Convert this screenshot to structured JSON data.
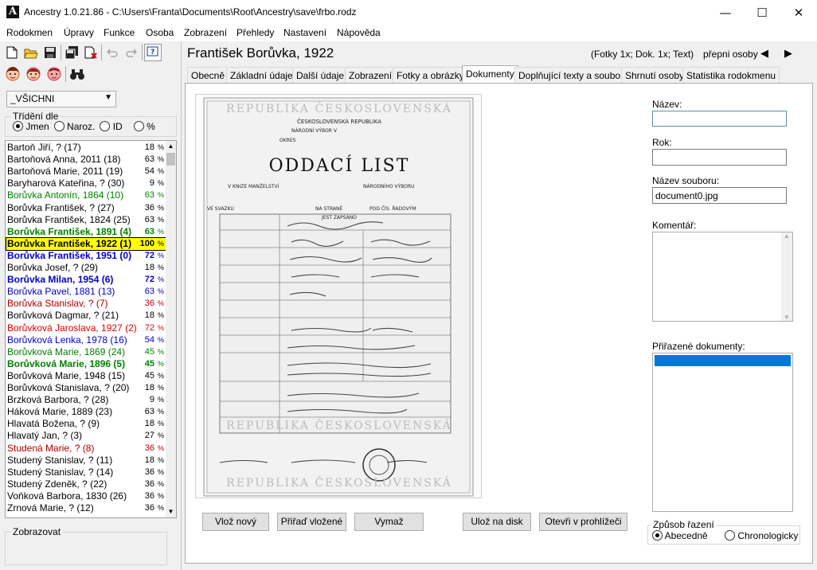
{
  "window": {
    "title": "Ancestry 1.0.21.86 - C:\\Users\\Franta\\Documents\\Root\\Ancestry\\save\\frbo.rodz",
    "app_icon_letter": "A"
  },
  "menu": [
    "Rodokmen",
    "Úpravy",
    "Funkce",
    "Osoba",
    "Zobrazení",
    "Přehledy",
    "Nastavení",
    "Nápověda"
  ],
  "left": {
    "filter_value": "_VŠICHNI",
    "sort_label": "Třídění dle",
    "sort_options": [
      "Jmen",
      "Naroz.",
      "ID",
      "%"
    ],
    "show_label": "Zobrazovat",
    "persons": [
      {
        "name": "Bartoň Jiří, ? (17)",
        "num": "18",
        "color": "#000000",
        "bold": false
      },
      {
        "name": "Bartoňová Anna, 2011 (18)",
        "num": "63",
        "color": "#000000",
        "bold": false
      },
      {
        "name": "Bartoňová Marie, 2011 (19)",
        "num": "54",
        "color": "#000000",
        "bold": false
      },
      {
        "name": "Baryharová Kateřina, ? (30)",
        "num": "9",
        "color": "#000000",
        "bold": false
      },
      {
        "name": "Borůvka Antonín, 1864 (10)",
        "num": "63",
        "color": "#008000",
        "bold": false
      },
      {
        "name": "Borůvka František, ? (27)",
        "num": "36",
        "color": "#000000",
        "bold": false
      },
      {
        "name": "Borůvka František, 1824 (25)",
        "num": "63",
        "color": "#000000",
        "bold": false
      },
      {
        "name": "Borůvka František, 1891 (4)",
        "num": "63",
        "color": "#008000",
        "bold": true
      },
      {
        "name": "Borůvka František, 1922 (1)",
        "num": "100",
        "color": "#000000",
        "bold": true,
        "selected": true
      },
      {
        "name": "Borůvka František, 1951 (0)",
        "num": "72",
        "color": "#0000cc",
        "bold": true
      },
      {
        "name": "Borůvka Josef, ? (29)",
        "num": "18",
        "color": "#000000",
        "bold": false
      },
      {
        "name": "Borůvka Milan, 1954 (6)",
        "num": "72",
        "color": "#0000cc",
        "bold": true
      },
      {
        "name": "Borůvka Pavel, 1881 (13)",
        "num": "63",
        "color": "#0000cc",
        "bold": false
      },
      {
        "name": "Borůvka Stanislav, ? (7)",
        "num": "36",
        "color": "#b00000",
        "bold": false
      },
      {
        "name": "Borůvková Dagmar, ? (21)",
        "num": "18",
        "color": "#000000",
        "bold": false
      },
      {
        "name": "Borůvková Jaroslava, 1927 (2)",
        "num": "72",
        "color": "#e00000",
        "bold": false
      },
      {
        "name": "Borůvková Lenka, 1978 (16)",
        "num": "54",
        "color": "#0000cc",
        "bold": false
      },
      {
        "name": "Borůvková Marie, 1869 (24)",
        "num": "45",
        "color": "#008000",
        "bold": false
      },
      {
        "name": "Borůvková Marie, 1896 (5)",
        "num": "45",
        "color": "#008000",
        "bold": true
      },
      {
        "name": "Borůvková Marie, 1948 (15)",
        "num": "45",
        "color": "#000000",
        "bold": false
      },
      {
        "name": "Borůvková Stanislava, ? (20)",
        "num": "18",
        "color": "#000000",
        "bold": false
      },
      {
        "name": "Brzková Barbora, ? (28)",
        "num": "9",
        "color": "#000000",
        "bold": false
      },
      {
        "name": "Háková Marie, 1889 (23)",
        "num": "63",
        "color": "#000000",
        "bold": false
      },
      {
        "name": "Hlavatá Božena, ? (9)",
        "num": "18",
        "color": "#000000",
        "bold": false
      },
      {
        "name": "Hlavatý Jan, ? (3)",
        "num": "27",
        "color": "#000000",
        "bold": false
      },
      {
        "name": "Studená Marie, ? (8)",
        "num": "36",
        "color": "#b00000",
        "bold": false
      },
      {
        "name": "Studený Stanislav, ? (11)",
        "num": "18",
        "color": "#000000",
        "bold": false
      },
      {
        "name": "Studený Stanislav, ? (14)",
        "num": "36",
        "color": "#000000",
        "bold": false
      },
      {
        "name": "Studený Zdeněk, ? (22)",
        "num": "36",
        "color": "#000000",
        "bold": false
      },
      {
        "name": "Voňková Barbora, 1830 (26)",
        "num": "36",
        "color": "#000000",
        "bold": false
      },
      {
        "name": "Zrnová Marie, ? (12)",
        "num": "36",
        "color": "#000000",
        "bold": false
      }
    ]
  },
  "header": {
    "person_title": "František Borůvka, 1922",
    "counts": "(Fotky 1x; Dok. 1x; Text)",
    "switch_label": "přepni osoby"
  },
  "tabs": [
    "Obecně",
    "Základní údaje",
    "Další údaje",
    "Zobrazení",
    "Fotky a obrázky",
    "Dokumenty",
    "Doplňující texty a soubory",
    "Shrnutí osoby",
    "Statistika rodokmenu"
  ],
  "active_tab": "Dokumenty",
  "document": {
    "image_lines": {
      "top_banner": "REPUBLIKA ČESKOSLOVENSKÁ",
      "state": "ČESKOSLOVENSKÁ REPUBLIKA",
      "committee": "NÁRODNÍ VÝBOR V",
      "district": "OKRES",
      "title": "ODDACÍ LIST",
      "book": "V KNIZE MANŽELSTVÍ",
      "committee2": "NÁRODNÍHO VÝBORU",
      "volume": "VE SVAZKU",
      "page": "NA STRANĚ",
      "order": "POD ČÍS. ŘADOVÝM",
      "registered": "JEST ZAPSÁNO",
      "bottom_banner": "REPUBLIKA ČESKOSLOVENSKÁ"
    },
    "form": {
      "name_label": "Název:",
      "name_value": "",
      "year_label": "Rok:",
      "year_value": "",
      "file_label": "Název souboru:",
      "file_value": "document0.jpg",
      "comment_label": "Komentář:",
      "assigned_label": "Přiřazené dokumenty:",
      "sort_label": "Způsob řazení",
      "sort_alpha": "Abecedně",
      "sort_chrono": "Chronologicky"
    },
    "buttons": {
      "insert_new": "Vlož nový",
      "assign_inserted": "Přiřaď vložené",
      "delete": "Vymaž",
      "save_disk": "Ulož na disk",
      "open_browser": "Otevři v prohlížeči"
    }
  },
  "colors": {
    "selection_bg": "#ffff00",
    "selection_border": "#000000",
    "list_selected": "#0078d7",
    "focus_border": "#5a8fa6"
  }
}
